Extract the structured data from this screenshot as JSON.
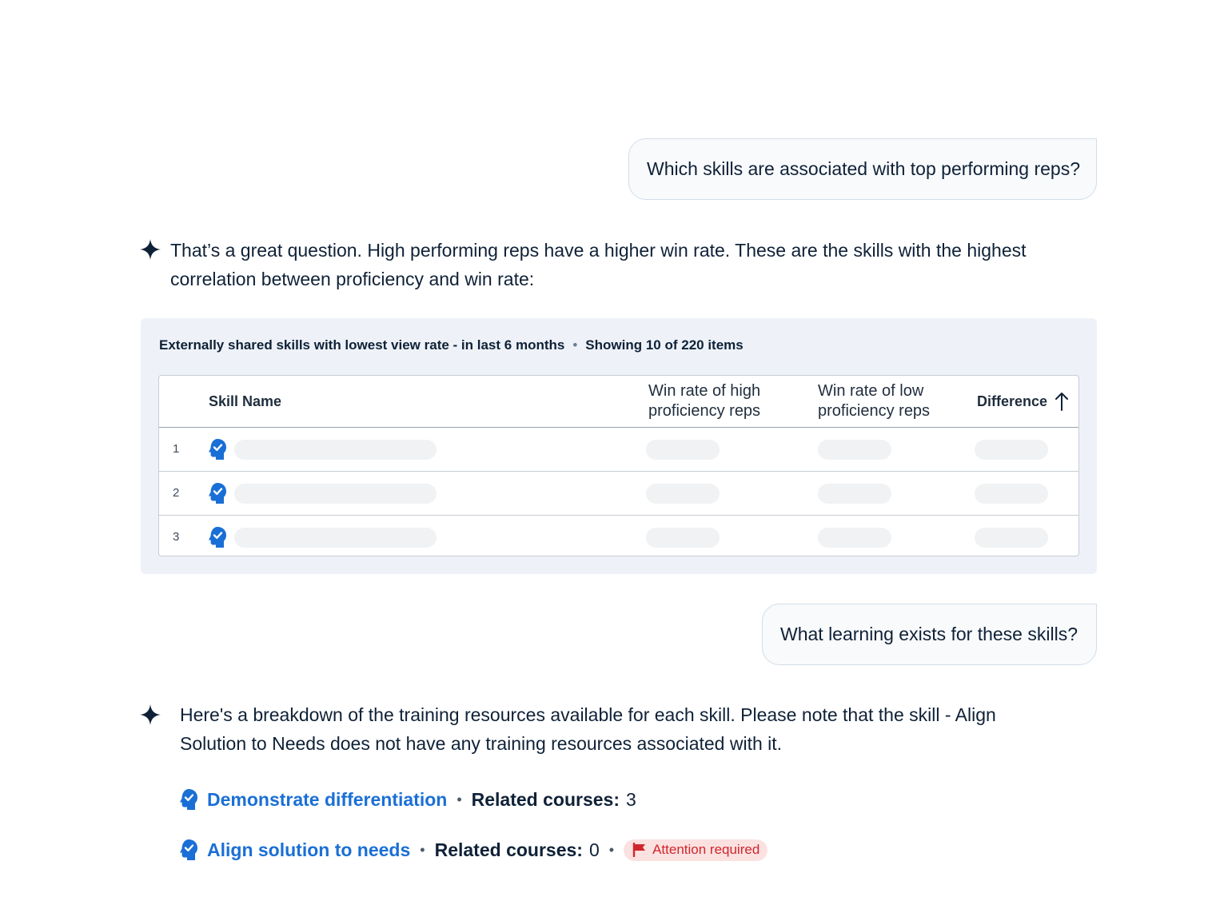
{
  "conversation": {
    "user_question_1": "Which skills are associated with top performing reps?",
    "assistant_reply_1": "That’s a great question. High performing reps have a higher win rate. These are the skills with the highest correlation between proficiency and win rate:",
    "user_question_2": "What learning exists for these skills?",
    "assistant_reply_2": "Here's a breakdown of the training resources available for each skill. Please note that the skill - Align Solution to Needs does not have any training resources associated with it."
  },
  "table_card": {
    "title": "Externally shared skills with lowest view rate - in last 6 months",
    "separator": "•",
    "count_text": "Showing 10 of 220 items",
    "columns": {
      "skill_name": "Skill Name",
      "win_high": "Win rate of high proficiency reps",
      "win_low": "Win rate of low proficiency reps",
      "difference": "Difference"
    },
    "sort_icon": "arrow-up-icon",
    "rows": [
      {
        "num": "1"
      },
      {
        "num": "2"
      },
      {
        "num": "3"
      }
    ]
  },
  "skills": [
    {
      "name": "Demonstrate differentiation",
      "related_label": "Related courses",
      "colon": ":",
      "count": "3"
    },
    {
      "name": "Align solution to needs",
      "related_label": "Related courses",
      "colon": ":",
      "count": "0",
      "badge": "Attention required"
    }
  ],
  "icons": {
    "assistant": "sparkle-icon",
    "skill": "skill-head-check-icon",
    "flag": "flag-icon"
  },
  "colors": {
    "text": "#0f2137",
    "link": "#1a6fd6",
    "card_bg": "#eef2f8",
    "bubble_border": "#d3dde8",
    "badge_bg": "#fce1e1",
    "badge_text": "#d0262b"
  }
}
